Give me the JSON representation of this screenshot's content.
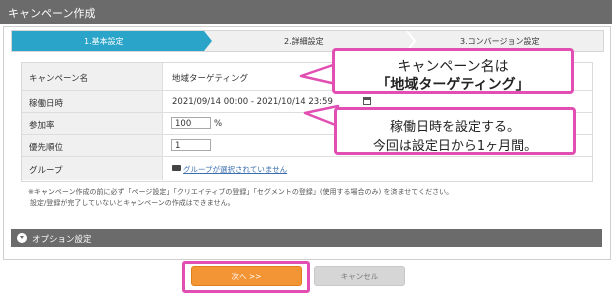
{
  "window": {
    "title": "キャンペーン作成"
  },
  "steps": [
    {
      "label": "1.基本設定",
      "active": true
    },
    {
      "label": "2.詳細設定",
      "active": false
    },
    {
      "label": "3.コンバージョン設定",
      "active": false
    }
  ],
  "form": {
    "name": {
      "label": "キャンペーン名",
      "value": "地域ターゲティング"
    },
    "period": {
      "label": "稼働日時",
      "value": "2021/09/14 00:00 - 2021/10/14 23:59"
    },
    "rate": {
      "label": "参加率",
      "value": "100",
      "unit": "%"
    },
    "priority": {
      "label": "優先順位",
      "value": "1"
    },
    "group": {
      "label": "グループ",
      "link": "グループが選択されていません"
    }
  },
  "notes": [
    "※キャンペーン作成の前に必ず「ページ設定」「クリエイティブの登録」「セグメントの登録」(使用する場合のみ) を済ませてください。",
    "設定/登録が完了していないとキャンペーンの作成はできません。"
  ],
  "options": {
    "label": "オプション設定"
  },
  "buttons": {
    "next": "次へ >>",
    "cancel": "キャンセル"
  },
  "callouts": {
    "name": {
      "line1": "キャンペーン名は",
      "line2": "「地域ターゲティング」"
    },
    "period": {
      "line1": "稼働日時を設定する。",
      "line2": "今回は設定日から1ヶ月間。"
    }
  },
  "colors": {
    "accent": "#2aa4c9",
    "highlight": "#e24fb2",
    "next_button": "#f39435",
    "bar": "#6b6b6b"
  }
}
